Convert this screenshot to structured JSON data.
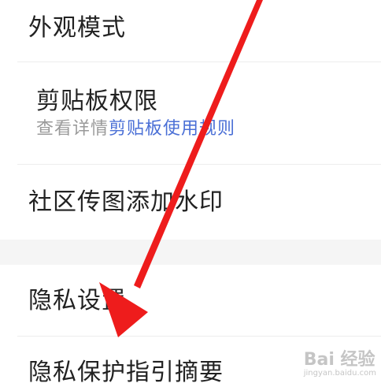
{
  "settings": {
    "appearance_label": "外观模式",
    "clipboard_label": "剪贴板权限",
    "clipboard_sub_prefix": "查看详情",
    "clipboard_sub_link": "剪贴板使用规则",
    "watermark_label": "社区传图添加水印",
    "privacy_label": "隐私设置",
    "privacy_guide_label": "隐私保护指引摘要"
  },
  "overlay": {
    "watermark_text": "Bai 经验",
    "watermark_sub": "jingyan.baidu.com",
    "arrow_color": "#ee1c1c"
  }
}
